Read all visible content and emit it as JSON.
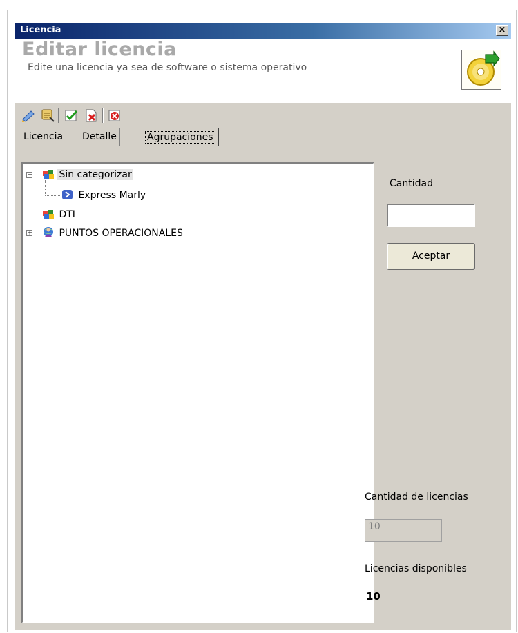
{
  "window": {
    "title": "Licencia",
    "close_glyph": "×"
  },
  "header": {
    "title": "Editar licencia",
    "subtitle": "Edite una licencia ya sea de software o sistema operativo",
    "icon": "cd-edit-icon"
  },
  "toolbar": {
    "buttons": [
      "new-icon",
      "search-icon",
      "accept-check-icon",
      "cancel-x-icon",
      "close-circle-icon"
    ]
  },
  "tabs": [
    {
      "label": "Licencia"
    },
    {
      "label": "Detalle"
    },
    {
      "label": "Agrupaciones",
      "active": true
    }
  ],
  "tree": {
    "nodes": [
      {
        "label": "Sin categorizar",
        "icon": "group-icon",
        "expanded": true,
        "selected": true
      },
      {
        "label": "Express Marly",
        "icon": "item-icon"
      },
      {
        "label": "DTI",
        "icon": "group-icon"
      },
      {
        "label": "PUNTOS OPERACIONALES",
        "icon": "globe-user-icon",
        "expanded": false
      }
    ]
  },
  "side": {
    "cantidad_label": "Cantidad",
    "cantidad_value": "",
    "accept_label": "Aceptar",
    "total_label": "Cantidad de licencias",
    "total_value": "10",
    "available_label": "Licencias disponibles",
    "available_value": "10"
  }
}
